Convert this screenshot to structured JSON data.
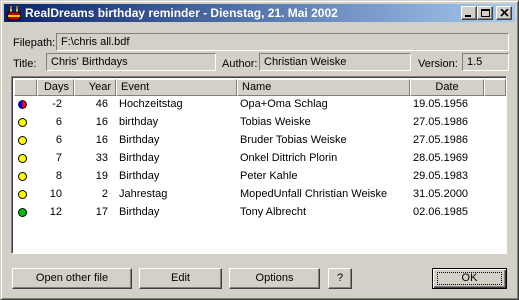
{
  "window": {
    "title": "RealDreams birthday reminder - Dienstag, 21. Mai 2002",
    "icon": "app-icon"
  },
  "file": {
    "filepath_label": "Filepath:",
    "filepath_value": "F:\\chris all.bdf",
    "title_label": "Title:",
    "title_value": "Chris' Birthdays",
    "author_label": "Author:",
    "author_value": "Christian Weiske",
    "version_label": "Version:",
    "version_value": "1.5"
  },
  "list": {
    "columns": [
      "Days",
      "Year",
      "Event",
      "Name",
      "Date"
    ],
    "rows": [
      {
        "days": "-2",
        "year": "46",
        "event": "Hochzeitstag",
        "name": "Opa+Oma Schlag",
        "date": "19.05.1956",
        "marker": "past",
        "color": "#0000ff",
        "color2": "#ff0000"
      },
      {
        "days": "6",
        "year": "16",
        "event": "birthday",
        "name": "Tobias Weiske",
        "date": "27.05.1986",
        "marker": "soon",
        "color": "#ffff00"
      },
      {
        "days": "6",
        "year": "16",
        "event": "Birthday",
        "name": "Bruder Tobias Weiske",
        "date": "27.05.1986",
        "marker": "soon",
        "color": "#ffff00"
      },
      {
        "days": "7",
        "year": "33",
        "event": "Birthday",
        "name": "Onkel Dittrich Plorin",
        "date": "28.05.1969",
        "marker": "soon",
        "color": "#ffff00"
      },
      {
        "days": "8",
        "year": "19",
        "event": "Birthday",
        "name": "Peter Kahle",
        "date": "29.05.1983",
        "marker": "soon",
        "color": "#ffff00"
      },
      {
        "days": "10",
        "year": "2",
        "event": "Jahrestag",
        "name": "MopedUnfall Christian Weiske",
        "date": "31.05.2000",
        "marker": "soon",
        "color": "#ffff00"
      },
      {
        "days": "12",
        "year": "17",
        "event": "Birthday",
        "name": "Tony Albrecht",
        "date": "02.06.1985",
        "marker": "later",
        "color": "#00c000"
      }
    ]
  },
  "buttons": {
    "open_other_file": "Open other file",
    "edit": "Edit",
    "options": "Options",
    "help": "?",
    "ok": "OK"
  }
}
